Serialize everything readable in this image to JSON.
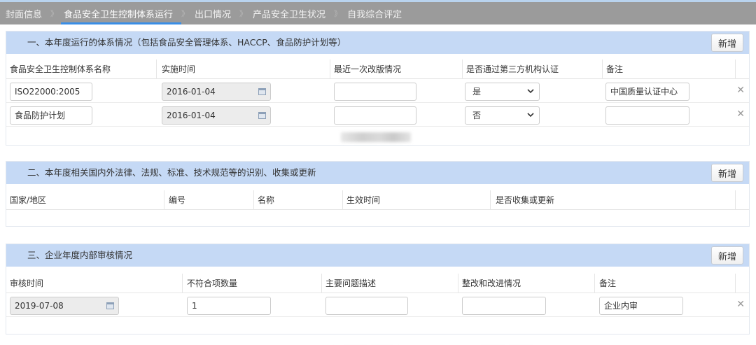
{
  "tabs": [
    {
      "label": "封面信息",
      "active": false
    },
    {
      "label": "食品安全卫生控制体系运行",
      "active": true
    },
    {
      "label": "出口情况",
      "active": false
    },
    {
      "label": "产品安全卫生状况",
      "active": false
    },
    {
      "label": "自我综合评定",
      "active": false
    }
  ],
  "tab_separator": "》",
  "section1": {
    "title": "一、本年度运行的体系情况（包括食品安全管理体系、HACCP、食品防护计划等）",
    "add_label": "新增",
    "columns": [
      "食品安全卫生控制体系名称",
      "实施时间",
      "最近一次改版情况",
      "是否通过第三方机构认证",
      "备注"
    ],
    "rows": [
      {
        "name": "ISO22000:2005",
        "date": "2016-01-04",
        "revision": "",
        "certified": "是",
        "remark": "中国质量认证中心"
      },
      {
        "name": "食品防护计划",
        "date": "2016-01-04",
        "revision": "",
        "certified": "否",
        "remark": ""
      }
    ]
  },
  "section2": {
    "title": "二、本年度相关国内外法律、法规、标准、技术规范等的识别、收集或更新",
    "add_label": "新增",
    "columns": [
      "国家/地区",
      "编号",
      "名称",
      "生效时间",
      "是否收集或更新"
    ]
  },
  "section3": {
    "title": "三、企业年度内部审核情况",
    "add_label": "新增",
    "columns": [
      "审核时间",
      "不符合项数量",
      "主要问题描述",
      "整改和改进情况",
      "备注"
    ],
    "rows": [
      {
        "date": "2019-07-08",
        "count": "1",
        "issues": "",
        "rectification": "",
        "remark": "企业内审"
      }
    ]
  },
  "icons": {
    "calendar": "calendar-icon",
    "dropdown": "chevron-down-icon",
    "delete": "close-icon"
  },
  "colors": {
    "tabbar": "#9b9b9b",
    "active_tab_underline": "#3a8ee6",
    "section_header": "#c5d9f5"
  }
}
